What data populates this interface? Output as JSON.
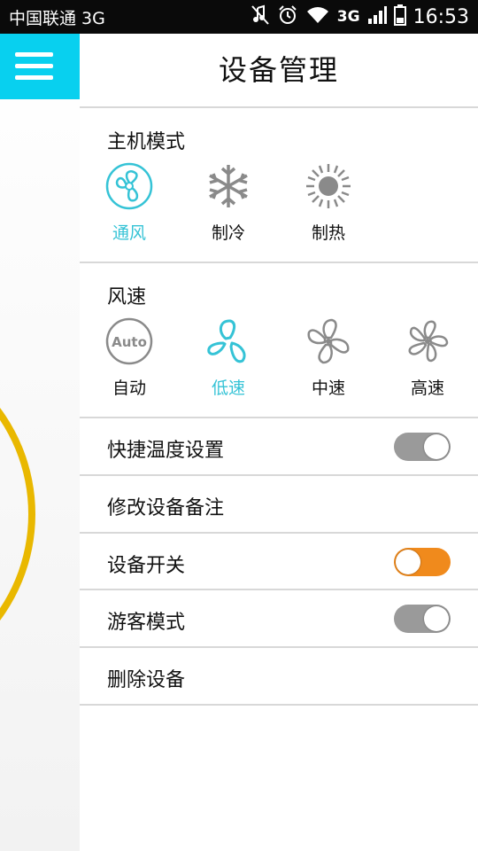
{
  "status_bar": {
    "carrier": "中国联通 3G",
    "network": "3G",
    "time": "16:53",
    "icons": [
      "mute-icon",
      "alarm-icon",
      "wifi-icon",
      "signal-icon",
      "battery-icon"
    ]
  },
  "header": {
    "title": "设备管理"
  },
  "menu": {
    "icon": "hamburger-menu-icon",
    "color": "#08d0ef"
  },
  "host_mode": {
    "title": "主机模式",
    "options": [
      {
        "label": "通风",
        "icon": "fan-circle-icon",
        "active": true
      },
      {
        "label": "制冷",
        "icon": "snowflake-icon",
        "active": false
      },
      {
        "label": "制热",
        "icon": "sun-icon",
        "active": false
      }
    ]
  },
  "fan_speed": {
    "title": "风速",
    "options": [
      {
        "label": "自动",
        "icon": "auto-icon",
        "icon_text": "Auto",
        "active": false
      },
      {
        "label": "低速",
        "icon": "fan-low-icon",
        "active": true
      },
      {
        "label": "中速",
        "icon": "fan-medium-icon",
        "active": false
      },
      {
        "label": "高速",
        "icon": "fan-high-icon",
        "active": false
      }
    ]
  },
  "settings": [
    {
      "label": "快捷温度设置",
      "toggle": true,
      "on": false
    },
    {
      "label": "修改设备备注",
      "toggle": false
    },
    {
      "label": "设备开关",
      "toggle": true,
      "on": true
    },
    {
      "label": "游客模式",
      "toggle": true,
      "on": false
    },
    {
      "label": "删除设备",
      "toggle": false
    }
  ],
  "colors": {
    "accent": "#35c3d6",
    "toggle_on": "#f08a1c",
    "toggle_off": "#9a9a9a",
    "ring": "#e9a400"
  }
}
